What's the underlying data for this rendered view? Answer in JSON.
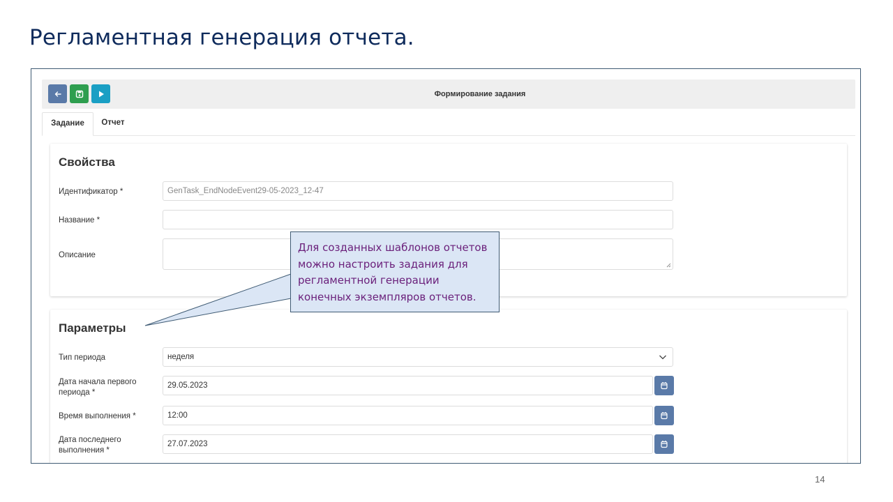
{
  "slide": {
    "title": "Регламентная генерация отчета.",
    "page_number": "14"
  },
  "toolbar": {
    "title": "Формирование задания",
    "buttons": [
      {
        "name": "back",
        "icon": "arrow-left-icon",
        "color": "#5a7aa8"
      },
      {
        "name": "save",
        "icon": "save-icon",
        "color": "#2e9e4f"
      },
      {
        "name": "run",
        "icon": "play-icon",
        "color": "#1a9fc4"
      }
    ]
  },
  "tabs": [
    {
      "label": "Задание",
      "active": true
    },
    {
      "label": "Отчет",
      "active": false
    }
  ],
  "properties": {
    "title": "Свойства",
    "id_label": "Идентификатор *",
    "id_value": "GenTask_EndNodeEvent29-05-2023_12-47",
    "name_label": "Название *",
    "name_value": "",
    "desc_label": "Описание",
    "desc_value": ""
  },
  "parameters": {
    "title": "Параметры",
    "period_type_label": "Тип периода",
    "period_type_value": "неделя",
    "start_date_label": "Дата начала первого периода *",
    "start_date_value": "29.05.2023",
    "exec_time_label": "Время выполнения *",
    "exec_time_value": "12:00",
    "last_date_label": "Дата последнего выполнения *",
    "last_date_value": "27.07.2023"
  },
  "callout": {
    "text": "Для созданных шаблонов отчетов можно настроить задания для регламентной генерации конечных экземпляров отчетов."
  }
}
